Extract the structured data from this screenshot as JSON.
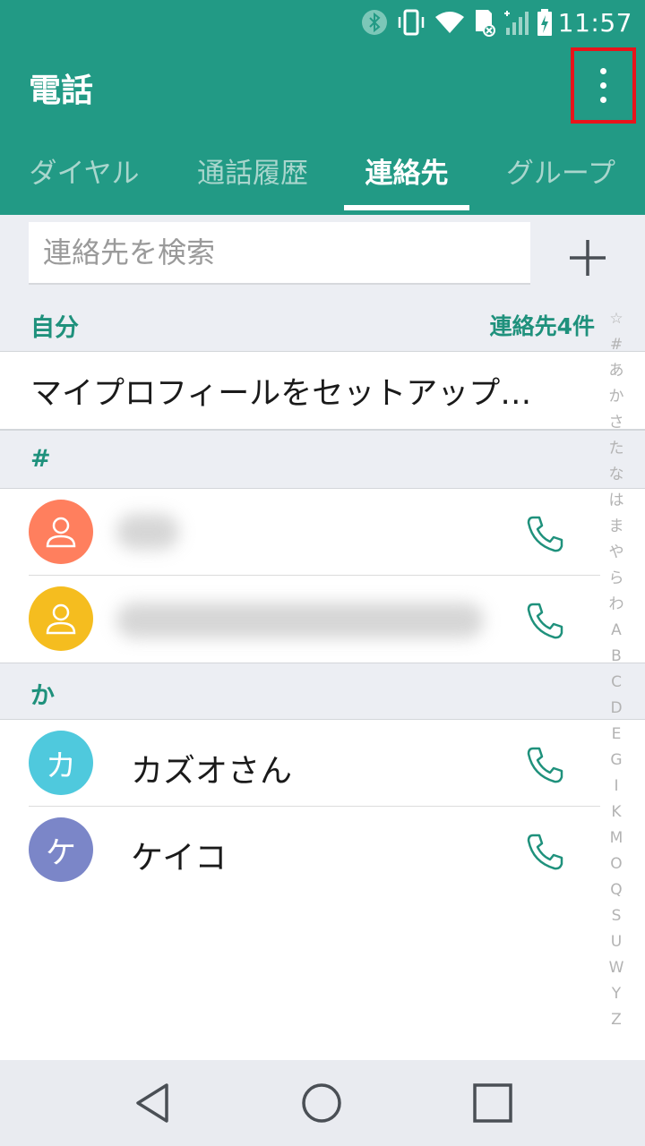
{
  "status_bar": {
    "time": "11:57",
    "icons": [
      "bluetooth-icon",
      "vibrate-icon",
      "wifi-icon",
      "sd-card-icon",
      "signal-icon",
      "battery-charging-icon"
    ]
  },
  "app_bar": {
    "title": "電話",
    "menu_icon": "more-vert-icon"
  },
  "tabs": [
    {
      "label": "ダイヤル",
      "active": false
    },
    {
      "label": "通話履歴",
      "active": false
    },
    {
      "label": "連絡先",
      "active": true
    },
    {
      "label": "グループ",
      "active": false
    }
  ],
  "search": {
    "placeholder": "連絡先を検索",
    "value": "",
    "add_icon": "plus-icon"
  },
  "sections": {
    "self": {
      "label": "自分",
      "count": "連絡先4件"
    },
    "hash": {
      "label": "#"
    },
    "ka": {
      "label": "か"
    }
  },
  "profile": {
    "label": "マイプロフィールをセットアップ…"
  },
  "contacts": [
    {
      "name": "",
      "avatar_text": "",
      "avatar_icon": "person-icon",
      "avatar_color": "#ff7f5e",
      "blurred": true
    },
    {
      "name": "",
      "avatar_text": "",
      "avatar_icon": "person-icon",
      "avatar_color": "#f5bd1f",
      "blurred": true
    },
    {
      "name": "カズオさん",
      "avatar_text": "カ",
      "avatar_color": "#4fc9dd",
      "blurred": false
    },
    {
      "name": "ケイコ",
      "avatar_text": "ケ",
      "avatar_color": "#7b86c8",
      "blurred": false
    }
  ],
  "call_icon": "phone-icon",
  "index_bar": [
    "☆",
    "#",
    "あ",
    "か",
    "さ",
    "た",
    "な",
    "は",
    "ま",
    "や",
    "ら",
    "わ",
    "A",
    "B",
    "C",
    "D",
    "E",
    "G",
    "I",
    "K",
    "M",
    "O",
    "Q",
    "S",
    "U",
    "W",
    "Y",
    "Z"
  ],
  "nav_bar": [
    "back-icon",
    "home-icon",
    "recents-icon"
  ],
  "colors": {
    "primary": "#229a85",
    "accent": "#1f917c",
    "highlight_box": "#e8141b"
  }
}
